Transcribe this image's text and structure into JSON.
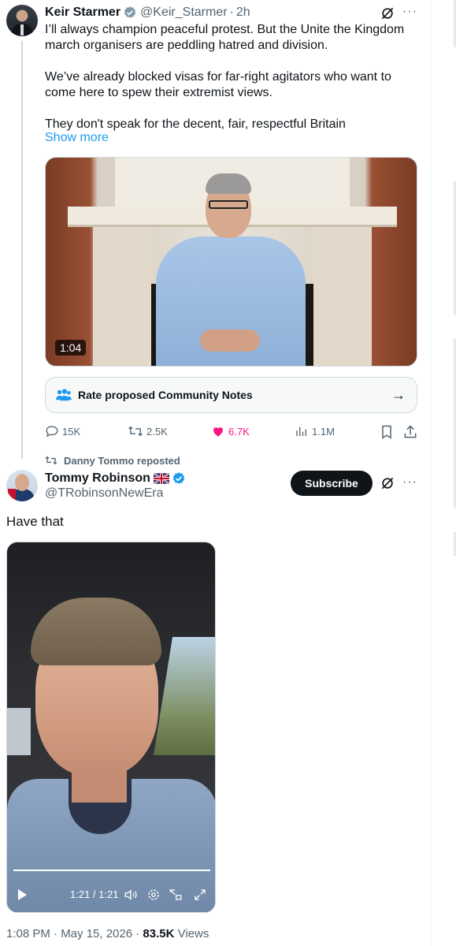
{
  "colors": {
    "accent": "#1d9bf0",
    "like": "#f91880",
    "text": "#0f1419",
    "secondary": "#536471",
    "verified_grey": "#829aab",
    "verified_blue": "#1d9bf0"
  },
  "tweet1": {
    "author_name": "Keir Starmer",
    "handle": "@Keir_Starmer",
    "time": "2h",
    "paragraphs": [
      "I’ll always champion peaceful protest. But the Unite the Kingdom march organisers are peddling hatred and division.",
      "We’ve already blocked visas for far-right agitators who want to come here to spew their extremist views.",
      "They don't speak for the decent, fair, respectful Britain"
    ],
    "show_more": "Show more",
    "video_duration": "1:04",
    "community_notes_label": "Rate proposed Community Notes",
    "replies": "15K",
    "reposts": "2.5K",
    "likes": "6.7K",
    "views": "1.1M",
    "liked": true
  },
  "tweet2": {
    "repost_by": "Danny Tommo reposted",
    "author_name": "Tommy Robinson",
    "handle": "@TRobinsonNewEra",
    "subscribe_label": "Subscribe",
    "text": "Have that",
    "video_time": "1:21 / 1:21",
    "video_progress": 1.0,
    "timestamp": "1:08 PM · May 15, 2026 · ",
    "views_count": "83.5K",
    "views_label": " Views"
  }
}
